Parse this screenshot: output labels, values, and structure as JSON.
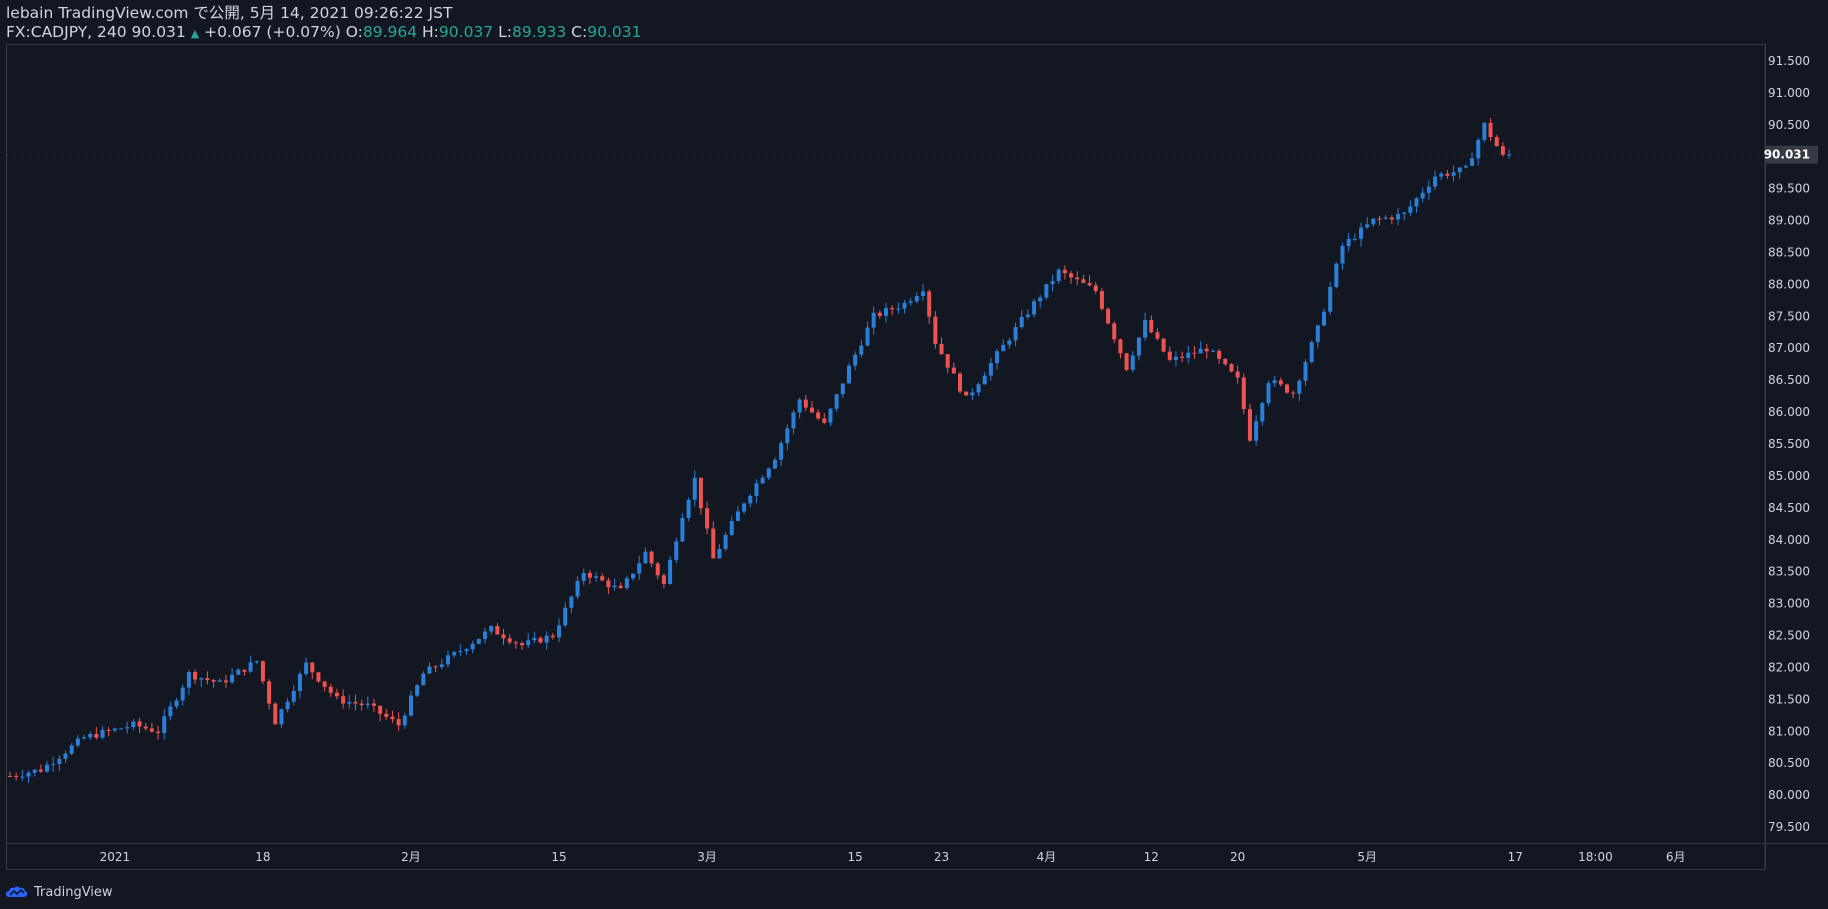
{
  "header": {
    "publish_line": "lebain TradingView.com で公開, 5月 14, 2021 09:26:22 JST",
    "symbol": "FX:CADJPY, 240",
    "last": "90.031",
    "up_glyph": "▲",
    "change": "+0.067 (+0.07%)",
    "o_label": "O:",
    "o_value": "89.964",
    "h_label": "H:",
    "h_value": "90.037",
    "l_label": "L:",
    "l_value": "89.933",
    "c_label": "C:",
    "c_value": "90.031"
  },
  "colors": {
    "background": "#131722",
    "up": "#2a7fd6",
    "down": "#ef5350",
    "text": "#d1d4dc",
    "grid_border": "#363a45",
    "price_tag": "#363a45",
    "values": "#26a69a"
  },
  "footer": {
    "brand": "TradingView",
    "logo_icon": "tradingview-cloud-icon"
  },
  "chart_data": {
    "type": "candlestick",
    "title": "",
    "xlabel": "",
    "ylabel": "",
    "ylim": [
      79.25,
      91.75
    ],
    "y_ticks": [
      "79.500",
      "80.000",
      "80.500",
      "81.000",
      "81.500",
      "82.000",
      "82.500",
      "83.000",
      "83.500",
      "84.000",
      "84.500",
      "85.000",
      "85.500",
      "86.000",
      "86.500",
      "87.000",
      "87.500",
      "88.000",
      "88.500",
      "89.000",
      "89.500",
      "90.000",
      "90.500",
      "91.000",
      "91.500"
    ],
    "x_ticks": [
      {
        "label": "2021",
        "at": 17
      },
      {
        "label": "18",
        "at": 41
      },
      {
        "label": "2月",
        "at": 65
      },
      {
        "label": "15",
        "at": 89
      },
      {
        "label": "3月",
        "at": 113
      },
      {
        "label": "15",
        "at": 137
      },
      {
        "label": "23",
        "at": 151
      },
      {
        "label": "4月",
        "at": 168
      },
      {
        "label": "12",
        "at": 185
      },
      {
        "label": "20",
        "at": 199
      },
      {
        "label": "5月",
        "at": 220
      },
      {
        "label": "17",
        "at": 244
      },
      {
        "label": "18:00",
        "at": 257
      },
      {
        "label": "6月",
        "at": 270
      }
    ],
    "last_price": "90.031",
    "x_index_range": [
      0,
      284
    ],
    "trend_anchors": [
      {
        "i": 0,
        "price": 80.3
      },
      {
        "i": 5,
        "price": 80.4
      },
      {
        "i": 12,
        "price": 80.9
      },
      {
        "i": 20,
        "price": 81.1
      },
      {
        "i": 24,
        "price": 81.0
      },
      {
        "i": 29,
        "price": 81.9
      },
      {
        "i": 34,
        "price": 81.75
      },
      {
        "i": 40,
        "price": 82.1
      },
      {
        "i": 43,
        "price": 81.15
      },
      {
        "i": 48,
        "price": 82.05
      },
      {
        "i": 53,
        "price": 81.5
      },
      {
        "i": 58,
        "price": 81.4
      },
      {
        "i": 63,
        "price": 81.1
      },
      {
        "i": 67,
        "price": 81.9
      },
      {
        "i": 72,
        "price": 82.2
      },
      {
        "i": 78,
        "price": 82.6
      },
      {
        "i": 83,
        "price": 82.35
      },
      {
        "i": 88,
        "price": 82.5
      },
      {
        "i": 93,
        "price": 83.5
      },
      {
        "i": 99,
        "price": 83.2
      },
      {
        "i": 103,
        "price": 83.8
      },
      {
        "i": 106,
        "price": 83.3
      },
      {
        "i": 109,
        "price": 84.4
      },
      {
        "i": 111,
        "price": 84.95
      },
      {
        "i": 114,
        "price": 83.7
      },
      {
        "i": 119,
        "price": 84.6
      },
      {
        "i": 124,
        "price": 85.3
      },
      {
        "i": 128,
        "price": 86.2
      },
      {
        "i": 132,
        "price": 85.8
      },
      {
        "i": 136,
        "price": 86.7
      },
      {
        "i": 140,
        "price": 87.5
      },
      {
        "i": 145,
        "price": 87.7
      },
      {
        "i": 148,
        "price": 87.95
      },
      {
        "i": 150,
        "price": 87.1
      },
      {
        "i": 155,
        "price": 86.2
      },
      {
        "i": 160,
        "price": 86.9
      },
      {
        "i": 166,
        "price": 87.7
      },
      {
        "i": 170,
        "price": 88.2
      },
      {
        "i": 176,
        "price": 87.9
      },
      {
        "i": 181,
        "price": 86.7
      },
      {
        "i": 184,
        "price": 87.4
      },
      {
        "i": 188,
        "price": 86.8
      },
      {
        "i": 194,
        "price": 87.0
      },
      {
        "i": 199,
        "price": 86.5
      },
      {
        "i": 201,
        "price": 85.6
      },
      {
        "i": 204,
        "price": 86.5
      },
      {
        "i": 208,
        "price": 86.3
      },
      {
        "i": 212,
        "price": 87.3
      },
      {
        "i": 216,
        "price": 88.6
      },
      {
        "i": 221,
        "price": 89.0
      },
      {
        "i": 226,
        "price": 89.1
      },
      {
        "i": 231,
        "price": 89.7
      },
      {
        "i": 236,
        "price": 89.8
      },
      {
        "i": 239,
        "price": 90.5
      },
      {
        "i": 242,
        "price": 90.0
      },
      {
        "i": 243,
        "price": 90.03
      }
    ]
  }
}
